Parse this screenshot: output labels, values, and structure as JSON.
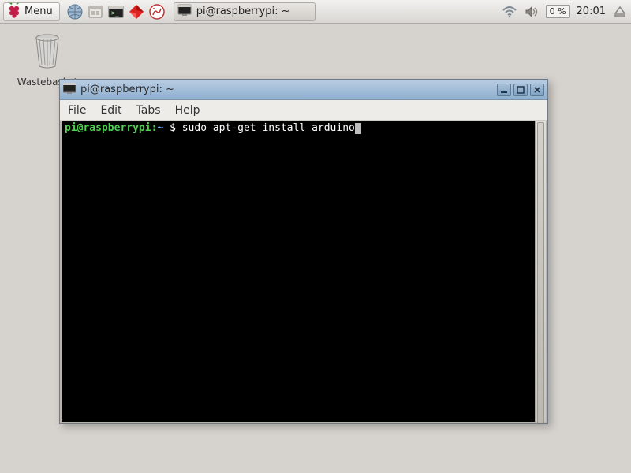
{
  "panel": {
    "menu_label": "Menu",
    "cpu": "0 %",
    "clock": "20:01",
    "task_label": "pi@raspberrypi: ~"
  },
  "desktop": {
    "wastebasket": "Wastebasket"
  },
  "terminal": {
    "title": "pi@raspberrypi: ~",
    "menus": {
      "file": "File",
      "edit": "Edit",
      "tabs": "Tabs",
      "help": "Help"
    },
    "prompt_user": "pi@raspberrypi",
    "prompt_path": "~",
    "prompt_symbol": "$",
    "command": "sudo apt-get install arduino"
  }
}
